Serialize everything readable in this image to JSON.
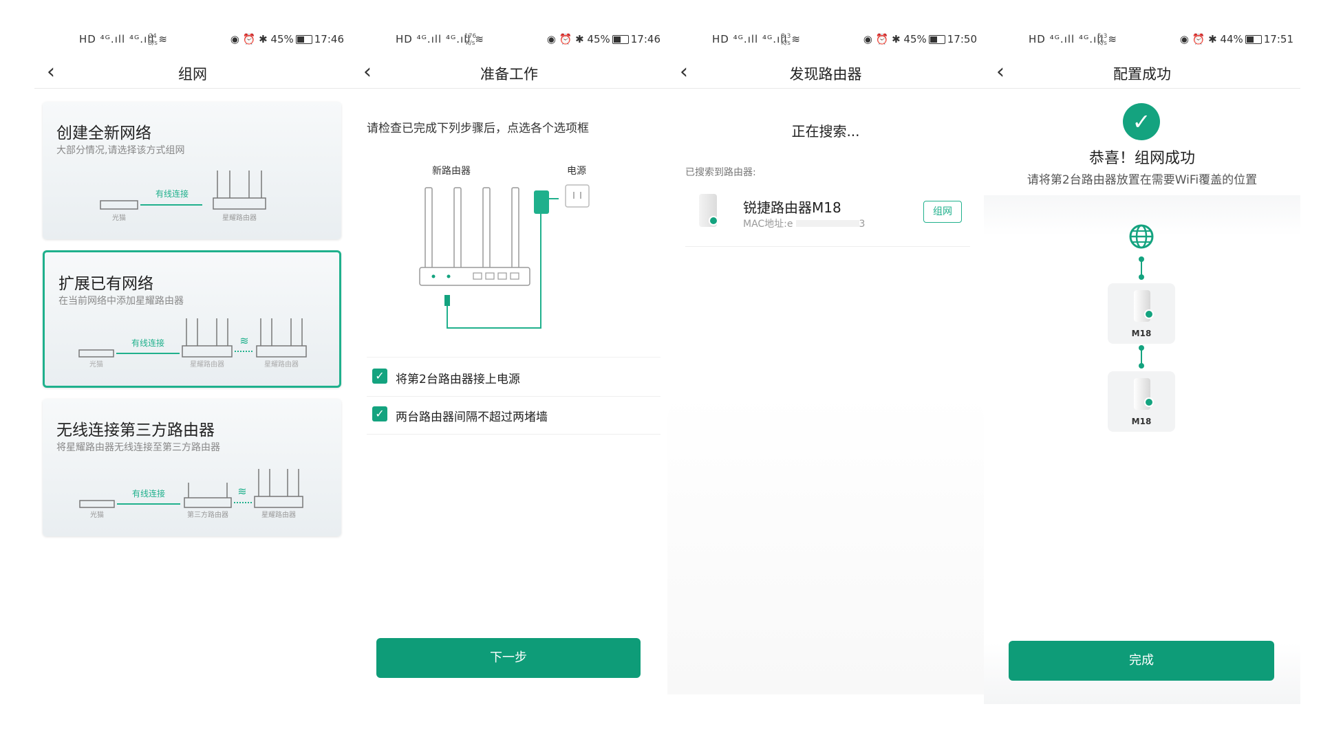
{
  "status_bars": [
    {
      "signal": "HD ⁴ᴳ.ıll ⁴ᴳ.ıll ≋",
      "net_rate": "24",
      "net_unit": "B/s",
      "icons": "◉ ⏰ ✱",
      "battery": "45%",
      "time": "17:46"
    },
    {
      "signal": "HD ⁴ᴳ.ıll ⁴ᴳ.ıll ≋",
      "net_rate": "176",
      "net_unit": "K/s",
      "icons": "◉ ⏰ ✱",
      "battery": "45%",
      "time": "17:46"
    },
    {
      "signal": "HD ⁴ᴳ.ıll ⁴ᴳ.ıll ≋",
      "net_rate": "8.3",
      "net_unit": "K/s",
      "icons": "◉ ⏰ ✱",
      "battery": "45%",
      "time": "17:50"
    },
    {
      "signal": "HD ⁴ᴳ.ıll ⁴ᴳ.ıll ≋",
      "net_rate": "5.3",
      "net_unit": "K/s",
      "icons": "◉ ⏰ ✱",
      "battery": "44%",
      "time": "17:51"
    }
  ],
  "screen1": {
    "title": "组网",
    "cards": [
      {
        "title": "创建全新网络",
        "subtitle": "大部分情况,请选择该方式组网",
        "link": "有线连接",
        "left_device": "光猫",
        "right_device": "星耀路由器"
      },
      {
        "title": "扩展已有网络",
        "subtitle": "在当前网络中添加星耀路由器",
        "link": "有线连接",
        "left_device": "光猫",
        "mid_device": "星耀路由器",
        "right_device": "星耀路由器"
      },
      {
        "title": "无线连接第三方路由器",
        "subtitle": "将星耀路由器无线连接至第三方路由器",
        "link": "有线连接",
        "left_device": "光猫",
        "mid_device": "第三方路由器",
        "right_device": "星耀路由器"
      }
    ]
  },
  "screen2": {
    "title": "准备工作",
    "hint": "请检查已完成下列步骤后，点选各个选项框",
    "diagram_labels": {
      "router": "新路由器",
      "power": "电源"
    },
    "checks": [
      {
        "label": "将第2台路由器接上电源",
        "checked": true
      },
      {
        "label": "两台路由器间隔不超过两堵墙",
        "checked": true
      }
    ],
    "next_button": "下一步"
  },
  "screen3": {
    "title": "发现路由器",
    "searching": "正在搜索...",
    "found_label": "已搜索到路由器:",
    "router": {
      "name": "锐捷路由器M18",
      "mac_prefix": "MAC地址:e",
      "mac_suffix": "3",
      "action": "组网"
    }
  },
  "screen4": {
    "title": "配置成功",
    "congrats": "恭喜！组网成功",
    "tip": "请将第2台路由器放置在需要WiFi覆盖的位置",
    "nodes": [
      "M18",
      "M18"
    ],
    "done_button": "完成"
  },
  "colors": {
    "accent": "#14a37f",
    "button": "#0e9c78",
    "text": "#222222"
  }
}
